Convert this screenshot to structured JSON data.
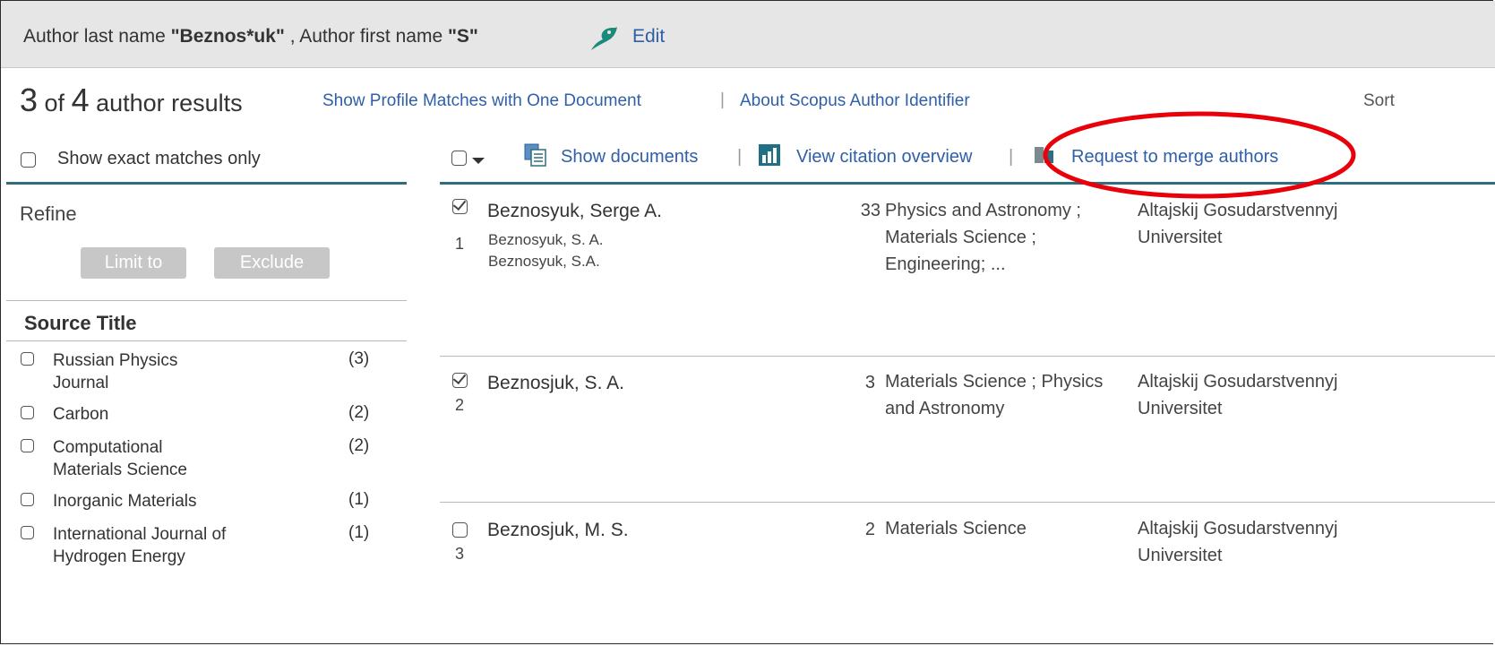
{
  "search_query": {
    "last_name_label": "Author last name ",
    "last_name_value": "\"Beznos*uk\"",
    "first_name_label": " , Author first name ",
    "first_name_value": "\"S\"",
    "edit_label": "Edit"
  },
  "results_header": {
    "shown": "3",
    "of": " of ",
    "total": "4",
    "suffix": " author results",
    "show_profile_matches": "Show Profile Matches with One Document",
    "about_identifier": "About Scopus Author Identifier",
    "sort_label": "Sort"
  },
  "sidebar": {
    "exact_matches_label": "Show exact matches only",
    "refine_label": "Refine",
    "limit_to_label": "Limit to",
    "exclude_label": "Exclude",
    "source_title_heading": "Source Title",
    "source_facets": [
      {
        "name": "Russian Physics Journal",
        "count": "(3)"
      },
      {
        "name": "Carbon",
        "count": "(2)"
      },
      {
        "name": "Computational Materials Science",
        "count": "(2)"
      },
      {
        "name": "Inorganic Materials",
        "count": "(1)"
      },
      {
        "name": "International Journal of Hydrogen Energy",
        "count": "(1)"
      }
    ]
  },
  "toolbar": {
    "show_documents": "Show documents",
    "view_citation_overview": "View citation overview",
    "request_merge": "Request to merge authors",
    "separator": "|"
  },
  "results": [
    {
      "number": "1",
      "checked": true,
      "name": "Beznosyuk, Serge A.",
      "variants": [
        "Beznosyuk, S. A.",
        "Beznosyuk, S.A."
      ],
      "documents": "33",
      "subjects": "Physics and Astronomy ; Materials Science ; Engineering; ...",
      "affiliation_line1": "Altajskij Gosudarstvennyj",
      "affiliation_line2": "Universitet"
    },
    {
      "number": "2",
      "checked": true,
      "name": "Beznosjuk, S. A.",
      "variants": [],
      "documents": "3",
      "subjects": "Materials Science ; Physics and Astronomy",
      "affiliation_line1": "Altajskij Gosudarstvennyj",
      "affiliation_line2": "Universitet"
    },
    {
      "number": "3",
      "checked": false,
      "name": "Beznosjuk, M. S.",
      "variants": [],
      "documents": "2",
      "subjects": "Materials Science",
      "affiliation_line1": "Altajskij Gosudarstvennyj",
      "affiliation_line2": "Universitet"
    }
  ],
  "colors": {
    "link": "#2f5fa7",
    "teal_rule": "#2e6e7e",
    "annotation_circle": "#e8000b",
    "button_disabled": "#c7c7c7"
  }
}
